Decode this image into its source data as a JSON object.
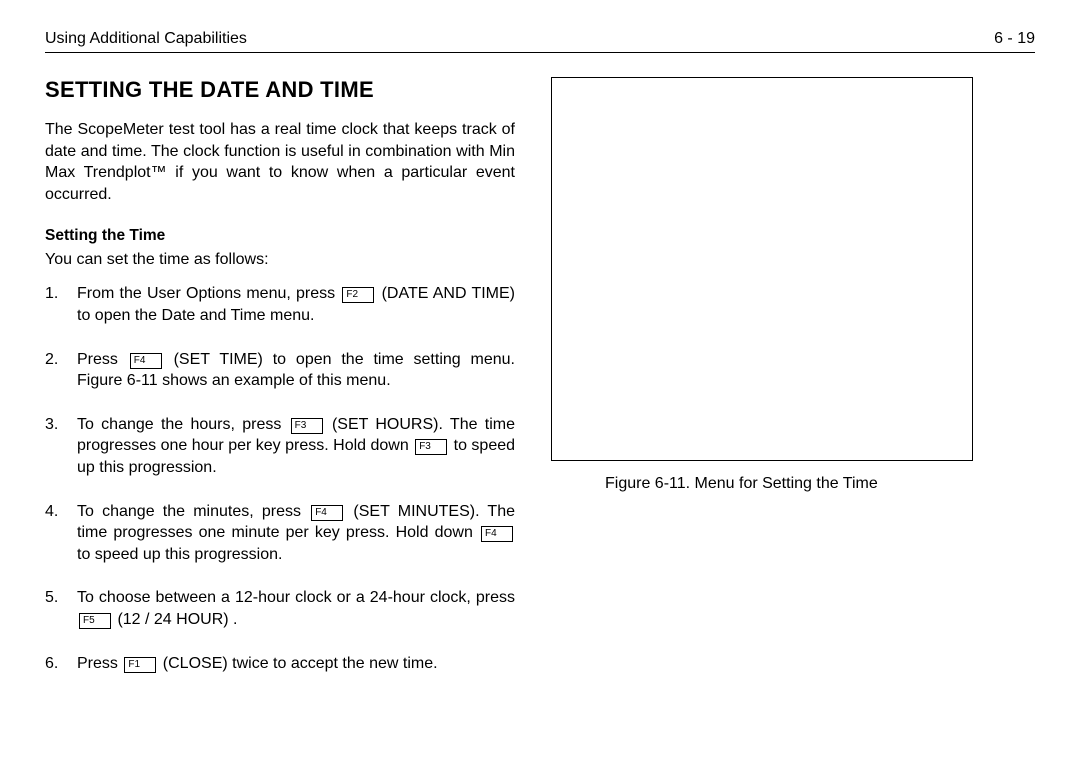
{
  "header": {
    "left": "Using Additional Capabilities",
    "right": "6 - 19"
  },
  "heading": "SETTING THE DATE AND TIME",
  "intro": "The ScopeMeter test tool has a real time clock that keeps track of date and time. The clock function is useful in combination with Min Max Trendplot™ if you want to know when a particular event occurred.",
  "subhead": "Setting the Time",
  "lead": "You can set the time as follows:",
  "keys": {
    "F1": "F1",
    "F2": "F2",
    "F3": "F3",
    "F4": "F4",
    "F5": "F5"
  },
  "steps": {
    "s1a": "From the User Options menu, press ",
    "s1b": " (DATE AND TIME) to open the Date and Time menu.",
    "s2a": "Press ",
    "s2b": " (SET TIME) to open the time setting menu. Figure 6-11 shows an example of this menu.",
    "s3a": "To change the hours, press ",
    "s3b": " (SET HOURS). The time progresses one hour per key press. Hold down ",
    "s3c": " to speed up this progression.",
    "s4a": "To change the minutes, press ",
    "s4b": " (SET MINUTES). The time progresses one minute per key press. Hold down ",
    "s4c": " to speed up this progression.",
    "s5a": "To choose between a 12-hour clock or a 24-hour clock, press ",
    "s5b": " (12 / 24 HOUR) .",
    "s6a": "Press ",
    "s6b": " (CLOSE) twice to accept the new time."
  },
  "caption": "Figure 6-11.   Menu for Setting the Time"
}
